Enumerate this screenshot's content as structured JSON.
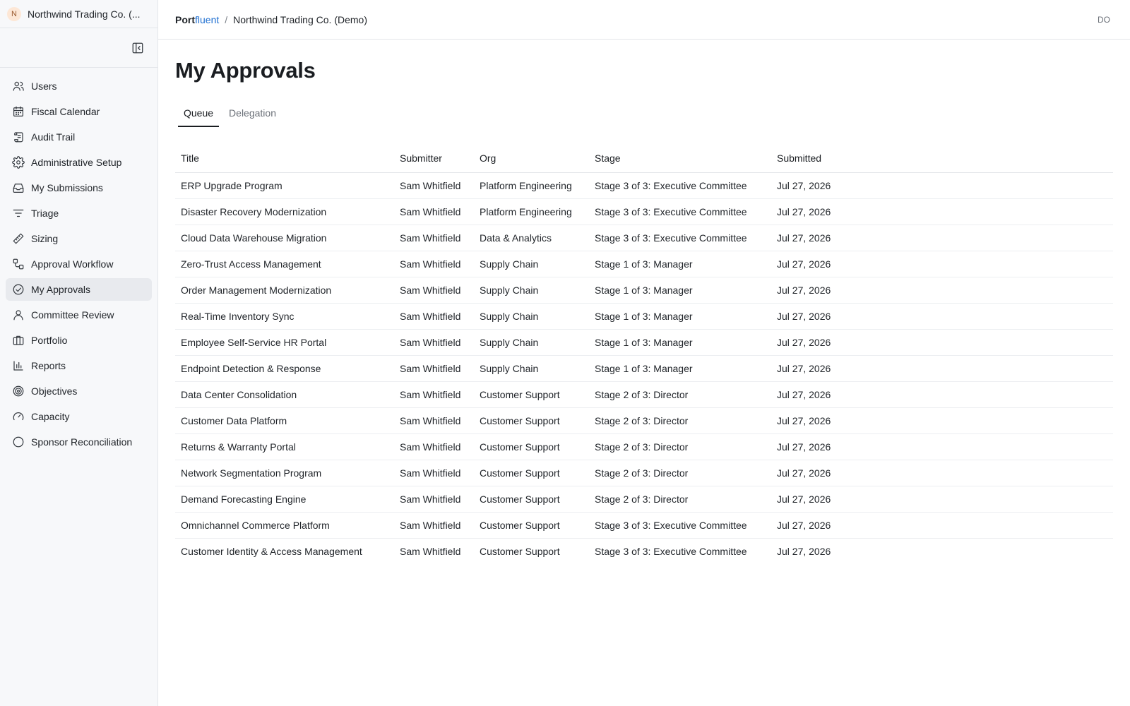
{
  "org": {
    "initial": "N",
    "name": "Northwind Trading Co. (..."
  },
  "sidebar": {
    "items": [
      {
        "label": "Users",
        "icon": "users-icon"
      },
      {
        "label": "Fiscal Calendar",
        "icon": "calendar-icon"
      },
      {
        "label": "Audit Trail",
        "icon": "scroll-icon"
      },
      {
        "label": "Administrative Setup",
        "icon": "gear-icon"
      },
      {
        "label": "My Submissions",
        "icon": "inbox-icon"
      },
      {
        "label": "Triage",
        "icon": "filter-icon"
      },
      {
        "label": "Sizing",
        "icon": "ruler-icon"
      },
      {
        "label": "Approval Workflow",
        "icon": "workflow-icon"
      },
      {
        "label": "My Approvals",
        "icon": "check-circle-icon",
        "active": true
      },
      {
        "label": "Committee Review",
        "icon": "user-icon"
      },
      {
        "label": "Portfolio",
        "icon": "briefcase-icon"
      },
      {
        "label": "Reports",
        "icon": "bar-chart-icon"
      },
      {
        "label": "Objectives",
        "icon": "target-icon"
      },
      {
        "label": "Capacity",
        "icon": "gauge-icon"
      },
      {
        "label": "Sponsor Reconciliation",
        "icon": "circle-icon"
      }
    ]
  },
  "header": {
    "brand_main": "Port",
    "brand_accent": "fluent",
    "separator": "/",
    "current": "Northwind Trading Co. (Demo)",
    "user_initials": "DO"
  },
  "page": {
    "title": "My Approvals",
    "tabs": [
      {
        "label": "Queue",
        "active": true
      },
      {
        "label": "Delegation",
        "active": false
      }
    ]
  },
  "table": {
    "columns": [
      "Title",
      "Submitter",
      "Org",
      "Stage",
      "Submitted"
    ],
    "rows": [
      [
        "ERP Upgrade Program",
        "Sam Whitfield",
        "Platform Engineering",
        "Stage 3 of 3: Executive Committee",
        "Jul 27, 2026"
      ],
      [
        "Disaster Recovery Modernization",
        "Sam Whitfield",
        "Platform Engineering",
        "Stage 3 of 3: Executive Committee",
        "Jul 27, 2026"
      ],
      [
        "Cloud Data Warehouse Migration",
        "Sam Whitfield",
        "Data & Analytics",
        "Stage 3 of 3: Executive Committee",
        "Jul 27, 2026"
      ],
      [
        "Zero-Trust Access Management",
        "Sam Whitfield",
        "Supply Chain",
        "Stage 1 of 3: Manager",
        "Jul 27, 2026"
      ],
      [
        "Order Management Modernization",
        "Sam Whitfield",
        "Supply Chain",
        "Stage 1 of 3: Manager",
        "Jul 27, 2026"
      ],
      [
        "Real-Time Inventory Sync",
        "Sam Whitfield",
        "Supply Chain",
        "Stage 1 of 3: Manager",
        "Jul 27, 2026"
      ],
      [
        "Employee Self-Service HR Portal",
        "Sam Whitfield",
        "Supply Chain",
        "Stage 1 of 3: Manager",
        "Jul 27, 2026"
      ],
      [
        "Endpoint Detection & Response",
        "Sam Whitfield",
        "Supply Chain",
        "Stage 1 of 3: Manager",
        "Jul 27, 2026"
      ],
      [
        "Data Center Consolidation",
        "Sam Whitfield",
        "Customer Support",
        "Stage 2 of 3: Director",
        "Jul 27, 2026"
      ],
      [
        "Customer Data Platform",
        "Sam Whitfield",
        "Customer Support",
        "Stage 2 of 3: Director",
        "Jul 27, 2026"
      ],
      [
        "Returns & Warranty Portal",
        "Sam Whitfield",
        "Customer Support",
        "Stage 2 of 3: Director",
        "Jul 27, 2026"
      ],
      [
        "Network Segmentation Program",
        "Sam Whitfield",
        "Customer Support",
        "Stage 2 of 3: Director",
        "Jul 27, 2026"
      ],
      [
        "Demand Forecasting Engine",
        "Sam Whitfield",
        "Customer Support",
        "Stage 2 of 3: Director",
        "Jul 27, 2026"
      ],
      [
        "Omnichannel Commerce Platform",
        "Sam Whitfield",
        "Customer Support",
        "Stage 3 of 3: Executive Committee",
        "Jul 27, 2026"
      ],
      [
        "Customer Identity & Access Management",
        "Sam Whitfield",
        "Customer Support",
        "Stage 3 of 3: Executive Committee",
        "Jul 27, 2026"
      ]
    ]
  }
}
